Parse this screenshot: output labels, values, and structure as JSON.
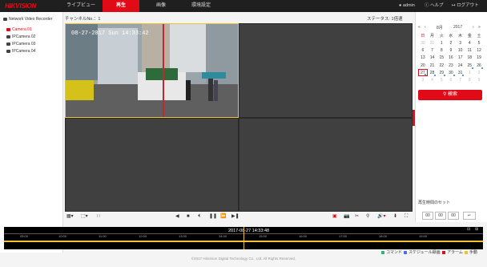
{
  "brand": "HIKVISION",
  "nav": {
    "liveview": "ライブビュー",
    "playback": "再生",
    "picture": "画像",
    "config": "環境設定"
  },
  "user": {
    "admin": "admin",
    "help": "ヘルプ",
    "logout": "ログアウト"
  },
  "sidebar": {
    "root": "Network Video Recorder",
    "cameras": [
      "Camera 01",
      "IPCamera 02",
      "IPCamera 03",
      "IPCamera 04"
    ]
  },
  "main": {
    "channel_label": "チャンネルNo.：",
    "channel_no": "1",
    "status": "ステータス: 1倍速"
  },
  "osd": {
    "timestamp": "08-27-2017 Sun 14:33:42"
  },
  "calendar": {
    "month": "8月",
    "year": "2017",
    "weekdays": [
      "日",
      "月",
      "火",
      "水",
      "木",
      "金",
      "土"
    ],
    "weeks": [
      [
        "30",
        "31",
        "1",
        "2",
        "3",
        "4",
        "5"
      ],
      [
        "6",
        "7",
        "8",
        "9",
        "10",
        "11",
        "12"
      ],
      [
        "13",
        "14",
        "15",
        "16",
        "17",
        "18",
        "19"
      ],
      [
        "20",
        "21",
        "22",
        "23",
        "24",
        "25",
        "26"
      ],
      [
        "27",
        "28",
        "29",
        "30",
        "31",
        "1",
        "2"
      ],
      [
        "3",
        "4",
        "5",
        "6",
        "7",
        "8",
        "9"
      ]
    ]
  },
  "search": "検索",
  "playback_time": {
    "title": "再生時間のセット",
    "h": "00",
    "m": "00",
    "s": "00"
  },
  "timeline": {
    "current": "2017-08-27 14:33:48",
    "ticks": [
      "05:00",
      "10:00",
      "11:00",
      "12:00",
      "13:00",
      "14:00",
      "15:00",
      "16:00",
      "17:00",
      "18:00",
      "19:00"
    ]
  },
  "legend": {
    "command": "コマンド",
    "schedule": "スケジュール録画",
    "alarm": "アラーム",
    "manual": "手動"
  },
  "colors": {
    "command": "#2bb673",
    "schedule": "#4a6cf7",
    "alarm": "#e10b17",
    "manual": "#f2c12e"
  },
  "footer": "©2017 Hikvision Digital Technology Co., Ltd. All Rights Reserved."
}
